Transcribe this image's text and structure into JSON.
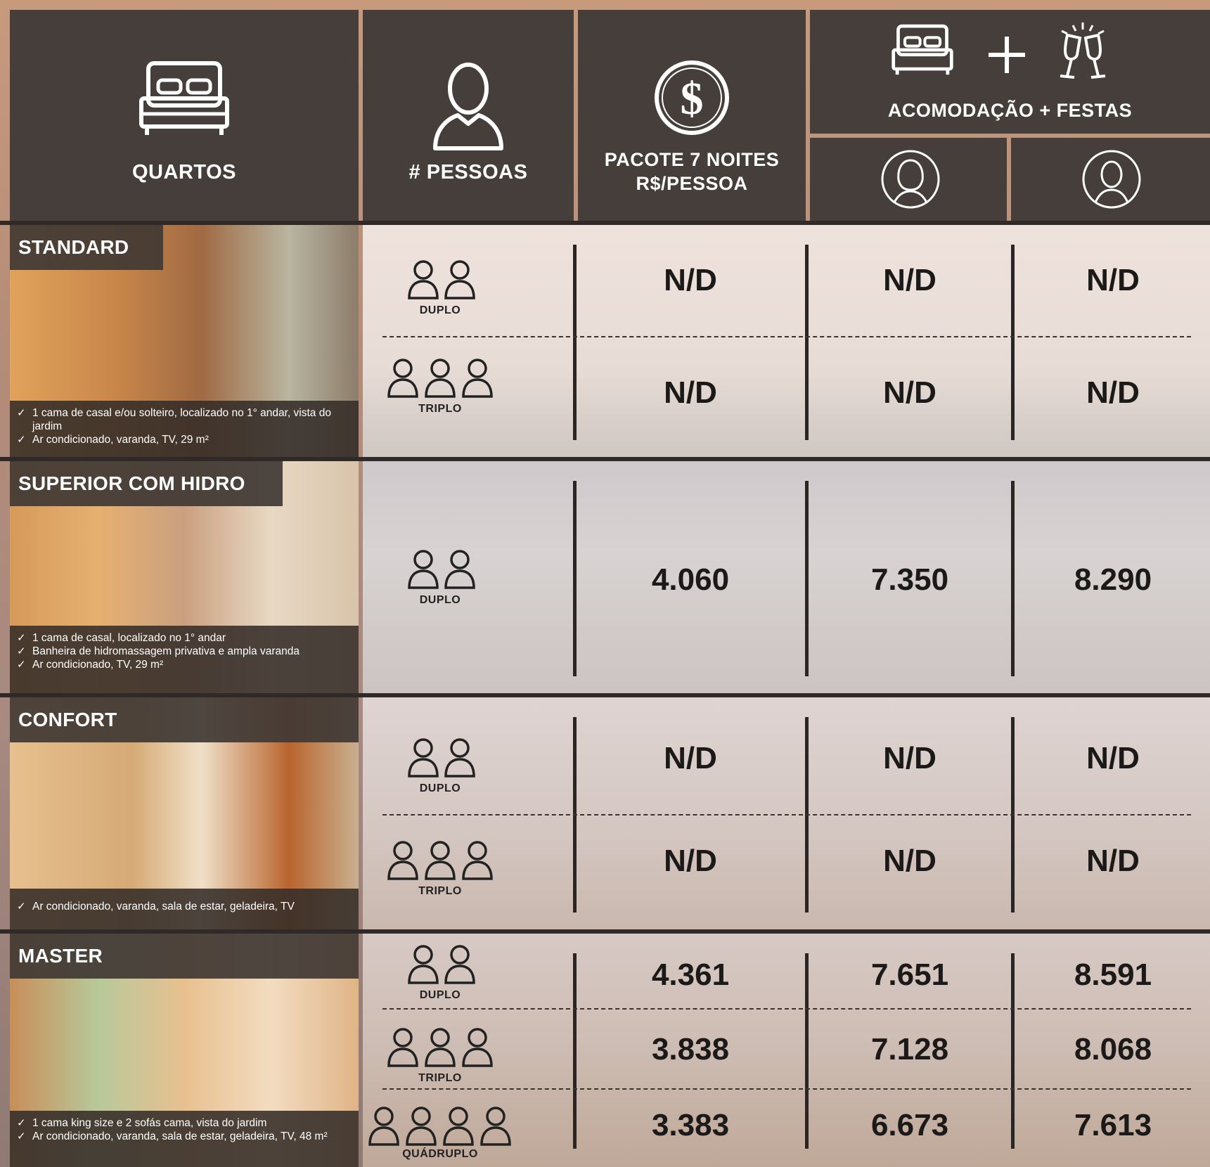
{
  "header": {
    "quartos": "QUARTOS",
    "pessoas": "# PESSOAS",
    "pacote_line1": "PACOTE 7 NOITES",
    "pacote_line2": "R$/PESSOA",
    "acomodacao": "ACOMODAÇÃO + FESTAS",
    "icons": [
      "bed-icon",
      "person-icon",
      "dollar-icon",
      "bed-icon",
      "plus-icon",
      "champagne-icon",
      "woman-avatar-icon",
      "man-avatar-icon"
    ]
  },
  "rooms": [
    {
      "name": "STANDARD",
      "features": [
        "1 cama de casal e/ou solteiro, localizado no 1° andar, vista do jardim",
        "Ar condicionado, varanda, TV, 29 m²"
      ],
      "rows": [
        {
          "type": "DUPLO",
          "pacote": "N/D",
          "fem": "N/D",
          "masc": "N/D"
        },
        {
          "type": "TRIPLO",
          "pacote": "N/D",
          "fem": "N/D",
          "masc": "N/D"
        }
      ]
    },
    {
      "name": "SUPERIOR COM HIDRO",
      "features": [
        "1 cama de casal, localizado no 1° andar",
        "Banheira de hidromassagem privativa e ampla varanda",
        "Ar condicionado, TV, 29 m²"
      ],
      "rows": [
        {
          "type": "DUPLO",
          "pacote": "4.060",
          "fem": "7.350",
          "masc": "8.290"
        }
      ]
    },
    {
      "name": "CONFORT",
      "features": [
        "Ar condicionado, varanda, sala de estar, geladeira, TV"
      ],
      "rows": [
        {
          "type": "DUPLO",
          "pacote": "N/D",
          "fem": "N/D",
          "masc": "N/D"
        },
        {
          "type": "TRIPLO",
          "pacote": "N/D",
          "fem": "N/D",
          "masc": "N/D"
        }
      ]
    },
    {
      "name": "MASTER",
      "features": [
        "1 cama king size e 2 sofás cama, vista do jardim",
        "Ar condicionado, varanda, sala de estar, geladeira, TV, 48 m²"
      ],
      "rows": [
        {
          "type": "DUPLO",
          "pacote": "4.361",
          "fem": "7.651",
          "masc": "8.591"
        },
        {
          "type": "TRIPLO",
          "pacote": "3.838",
          "fem": "7.128",
          "masc": "8.068"
        },
        {
          "type": "QUÁDRUPLO",
          "pacote": "3.383",
          "fem": "6.673",
          "masc": "7.613"
        }
      ]
    }
  ]
}
